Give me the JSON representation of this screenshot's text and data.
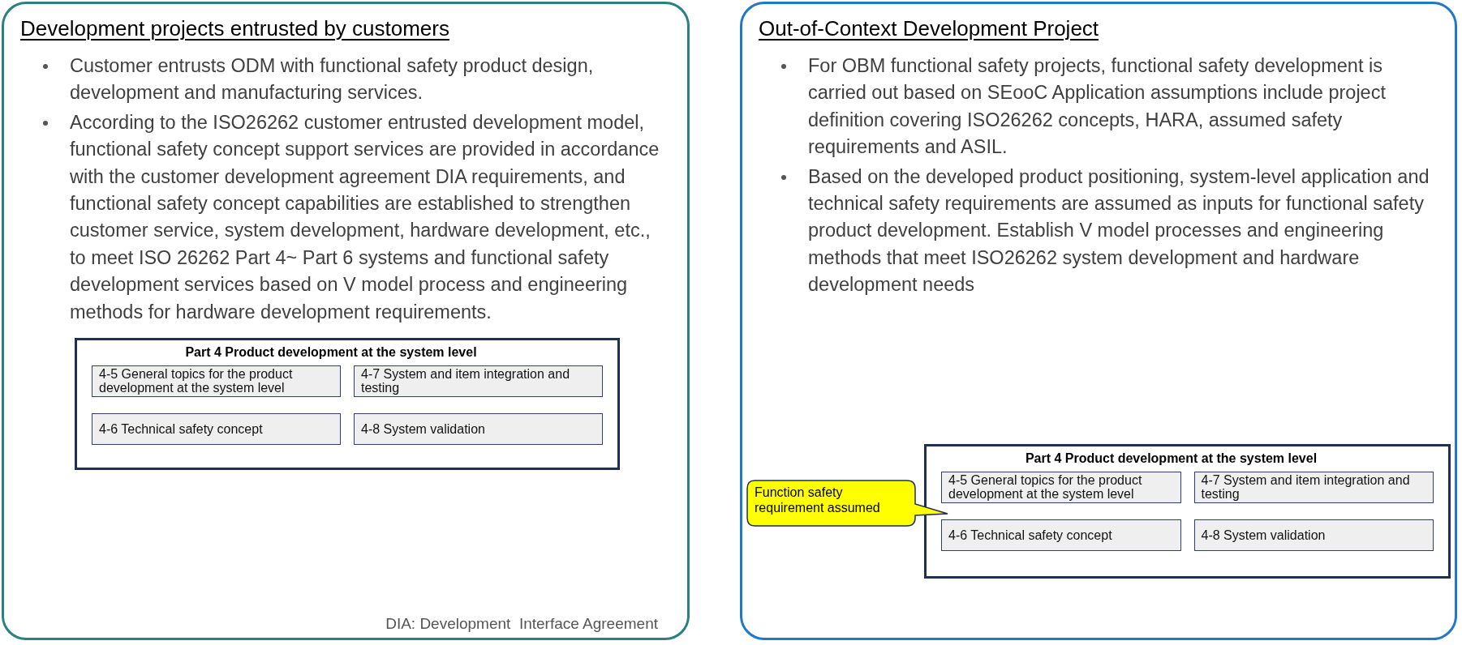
{
  "panels": [
    {
      "title": "Development projects entrusted by customers",
      "color": "#2b8080",
      "bullets": [
        "Customer entrusts ODM with functional safety product design, development and manufacturing services.",
        "According to the ISO26262 customer entrusted development model, functional safety concept support services are provided in accordance with the customer development agreement DIA requirements, and functional safety concept capabilities are established to strengthen customer service, system development, hardware development, etc., to meet ISO 26262 Part 4~ Part 6 systems and functional safety development services based on V model process and engineering methods for hardware development requirements."
      ],
      "diagram": {
        "title": "Part 4 Product development at the system level",
        "boxes": [
          "4-5 General topics for the product development at the system level",
          "4-7 System and item integration and testing",
          "4-6 Technical safety concept",
          "4-8 System validation"
        ]
      },
      "note": "DIA: Development  Interface Agreement"
    },
    {
      "title": "Out-of-Context Development Project",
      "color": "#1f78c8",
      "bullets": [
        "For OBM functional safety projects, functional safety development is carried out based on SEooC Application assumptions include project definition covering ISO26262 concepts, HARA, assumed safety requirements and ASIL.",
        "Based on the developed product positioning, system-level application and technical safety requirements are assumed as inputs for functional safety product development. Establish V model processes and engineering methods that meet ISO26262 system development and hardware development needs"
      ],
      "diagram": {
        "title": "Part 4 Product development at the system level",
        "boxes": [
          "4-5 General topics for the product development at the system level",
          "4-7 System and item integration and testing",
          "4-6 Technical safety concept",
          "4-8 System validation"
        ]
      },
      "callout": "Function safety requirement assumed"
    }
  ]
}
